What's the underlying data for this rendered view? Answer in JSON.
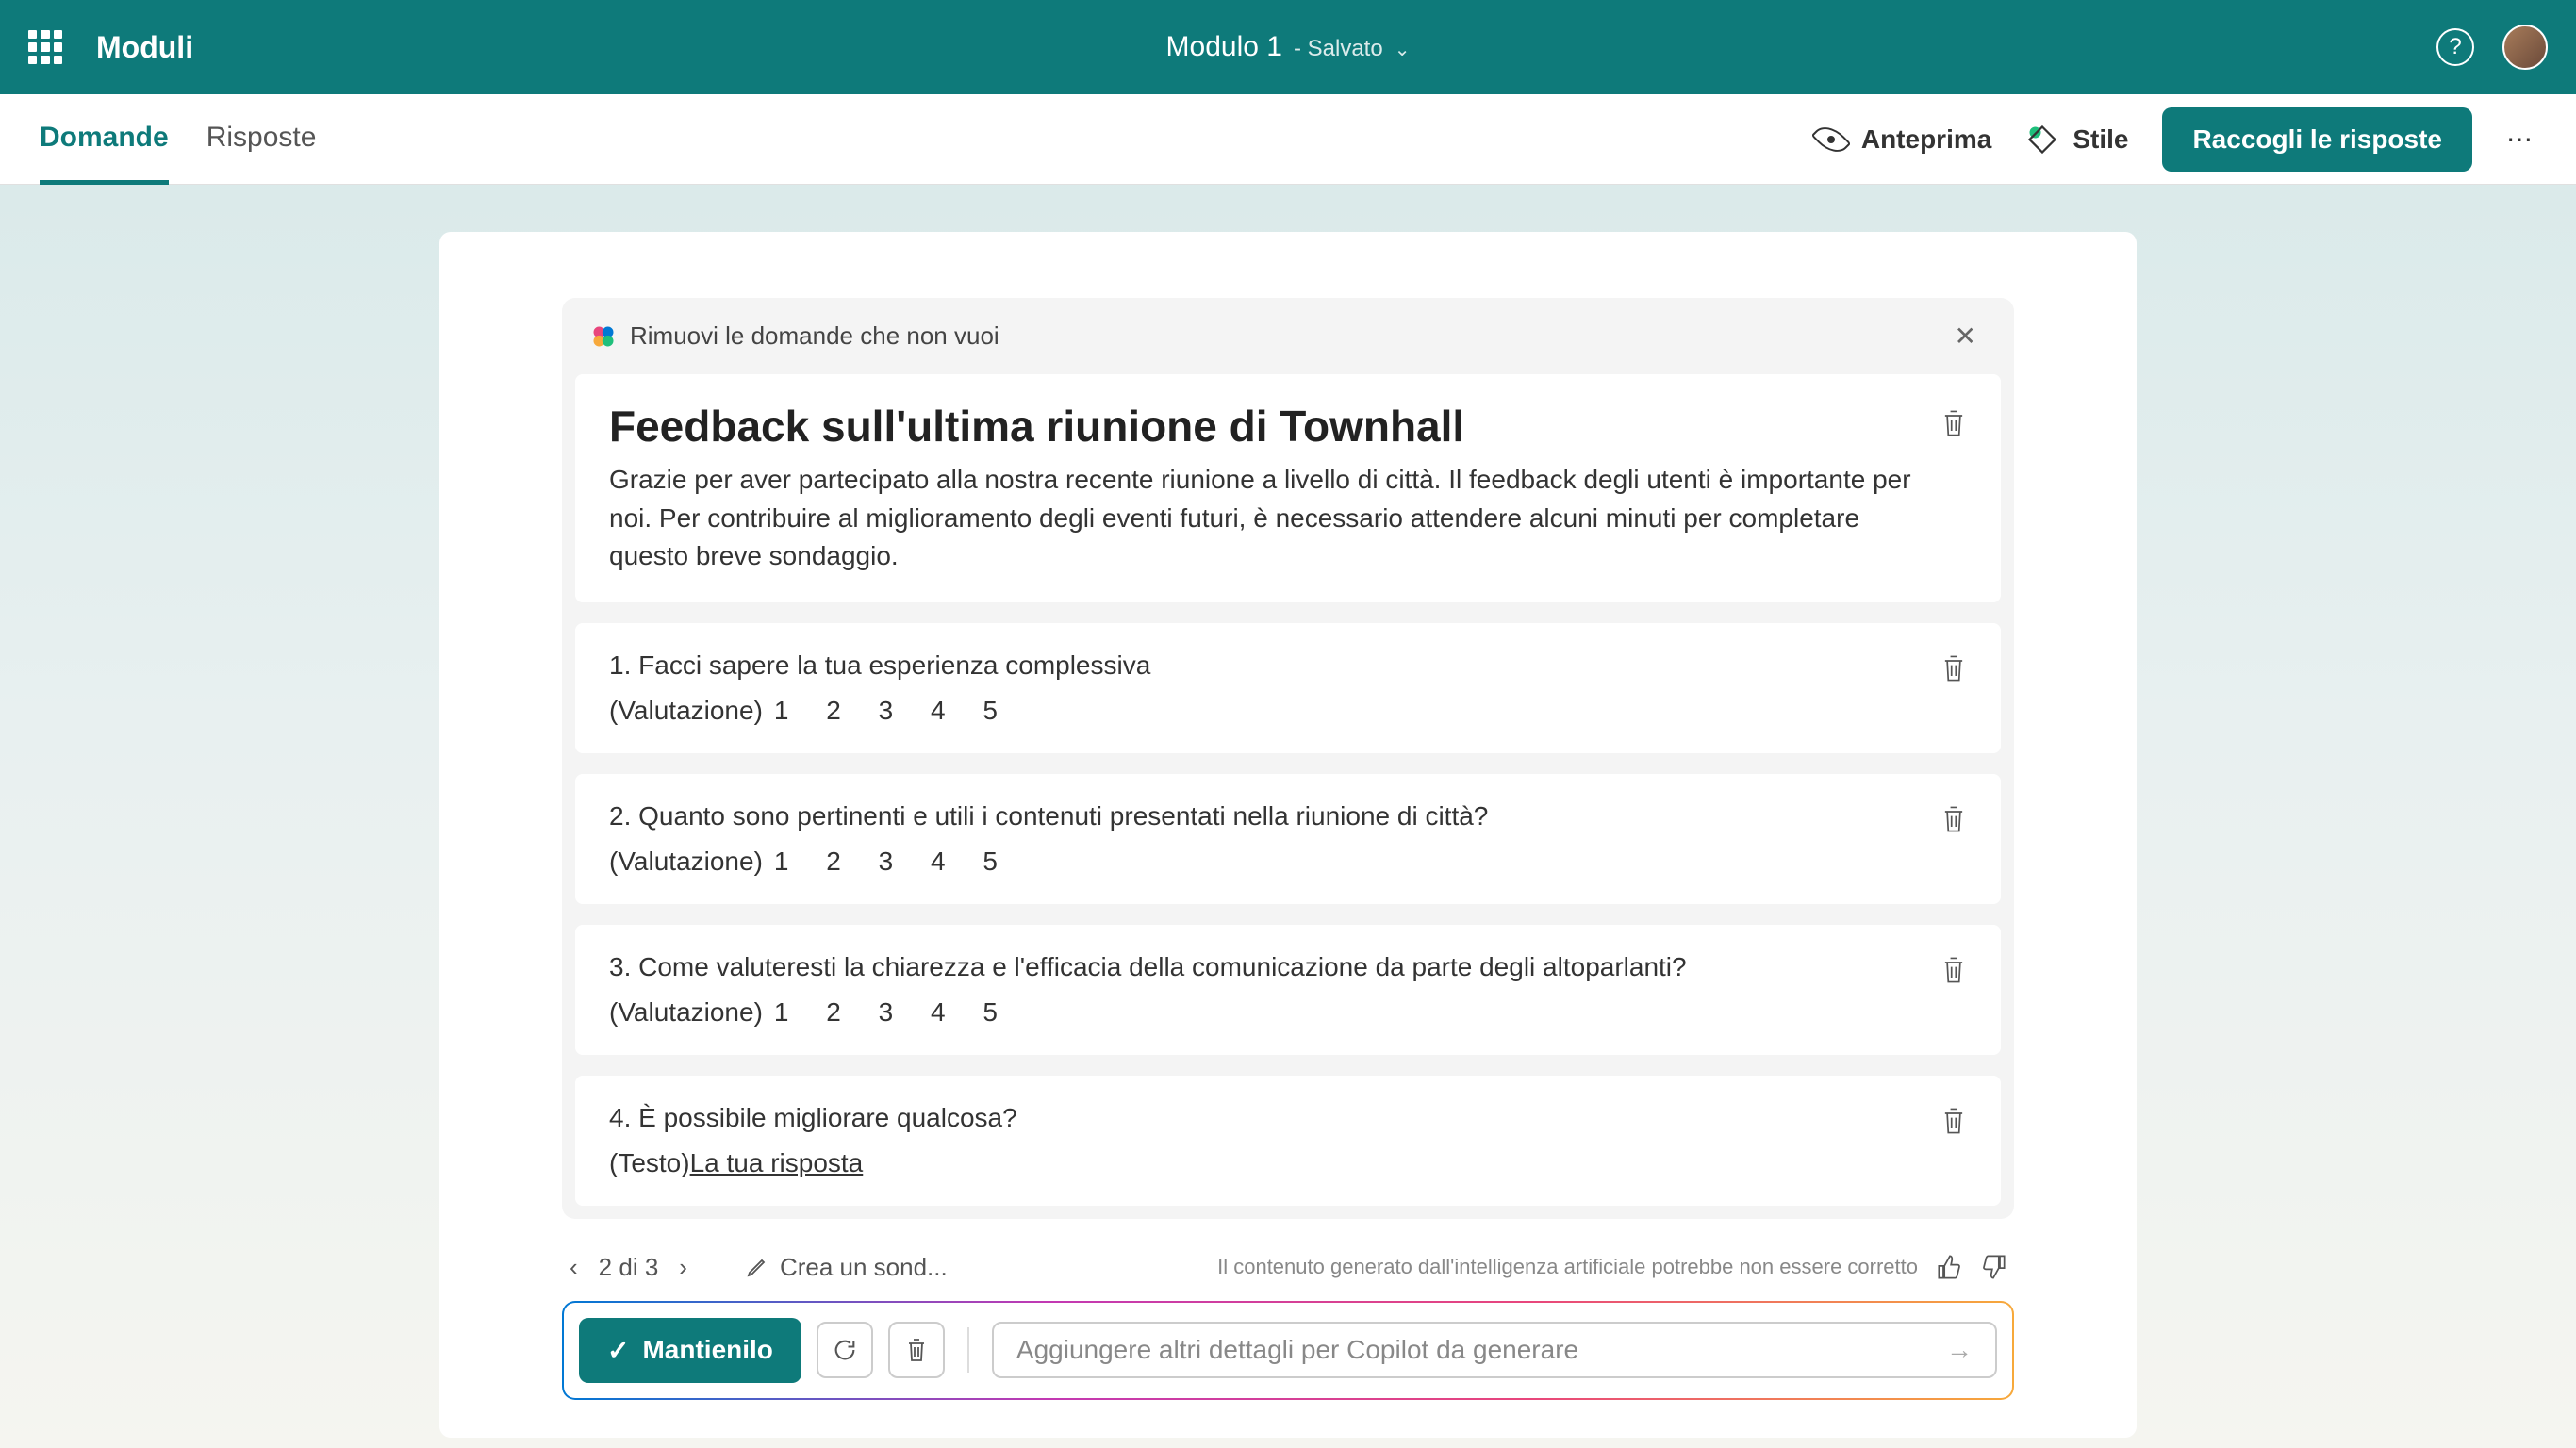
{
  "header": {
    "appName": "Moduli",
    "docTitle": "Modulo 1",
    "docStatus": "- Salvato"
  },
  "toolbar": {
    "tabs": {
      "questions": "Domande",
      "responses": "Risposte"
    },
    "preview": "Anteprima",
    "style": "Stile",
    "collect": "Raccogli le risposte"
  },
  "copilot": {
    "removeLabel": "Rimuovi le domande che non vuoi",
    "title": "Feedback sull'ultima riunione di Townhall",
    "description": "Grazie per aver partecipato alla nostra recente riunione a livello di città. Il feedback degli utenti è importante per noi. Per contribuire al miglioramento degli eventi futuri, è necessario attendere alcuni minuti per completare questo breve sondaggio.",
    "questions": [
      {
        "num": "1.",
        "text": "Facci sapere la tua esperienza complessiva",
        "type": "(Valutazione)",
        "scale": "1   2   3   4   5"
      },
      {
        "num": "2.",
        "text": "Quanto sono pertinenti e utili i contenuti presentati nella riunione di città?",
        "type": "(Valutazione)",
        "scale": "1   2   3   4   5"
      },
      {
        "num": "3.",
        "text": "Come valuteresti la chiarezza e l'efficacia della comunicazione da parte degli altoparlanti?",
        "type": "(Valutazione)",
        "scale": "1   2   3   4   5"
      },
      {
        "num": "4.",
        "text": "È possibile migliorare qualcosa?",
        "type": "(Testo)",
        "answer": "La tua risposta"
      }
    ]
  },
  "nav": {
    "pageIndicator": "2 di 3",
    "editPrompt": "Crea un sond...",
    "disclaimer": "Il contenuto generato dall'intelligenza artificiale potrebbe non essere corretto"
  },
  "actions": {
    "keep": "Mantienilo",
    "inputPlaceholder": "Aggiungere altri dettagli per Copilot da generare"
  }
}
